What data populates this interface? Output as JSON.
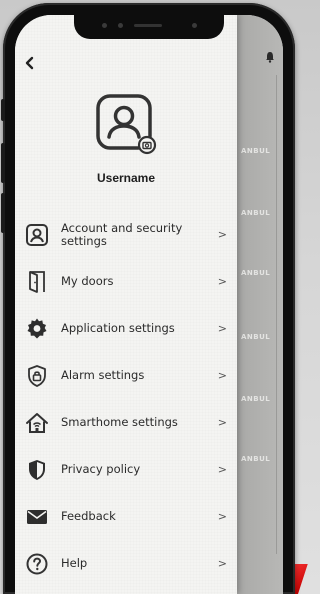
{
  "profile": {
    "username": "Username"
  },
  "menu": {
    "items": [
      {
        "label": "Account and security settings",
        "icon": "user-id-card-icon"
      },
      {
        "label": "My doors",
        "icon": "door-icon"
      },
      {
        "label": "Application settings",
        "icon": "gear-icon"
      },
      {
        "label": "Alarm settings",
        "icon": "lock-shield-icon"
      },
      {
        "label": "Smarthome settings",
        "icon": "smart-home-icon"
      },
      {
        "label": "Privacy policy",
        "icon": "shield-icon"
      },
      {
        "label": "Feedback",
        "icon": "envelope-icon"
      },
      {
        "label": "Help",
        "icon": "question-circle-icon"
      }
    ],
    "chevron": ">"
  },
  "background_brand_text": "ANBUL",
  "colors": {
    "accent": "#e31e24",
    "text": "#2a2a2a",
    "panel": "#f4f4f2"
  }
}
